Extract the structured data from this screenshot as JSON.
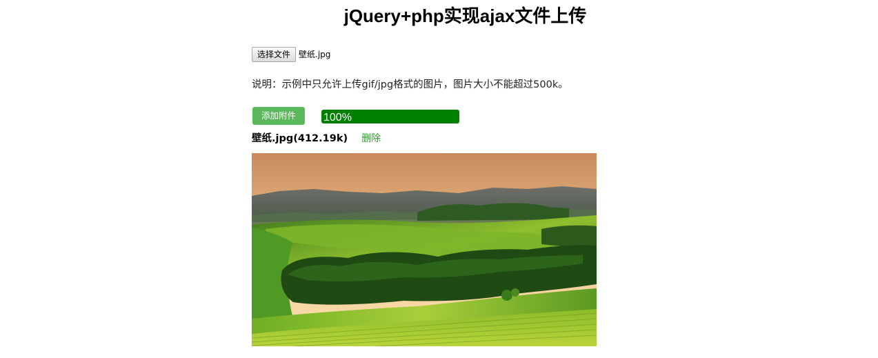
{
  "page": {
    "title": "jQuery+php实现ajax文件上传"
  },
  "file_input": {
    "button_label": "选择文件",
    "selected_file": "壁纸.jpg"
  },
  "note": "说明：示例中只允许上传gif/jpg格式的图片，图片大小不能超过500k。",
  "upload": {
    "add_button_label": "添加附件",
    "progress_text": "100%",
    "progress_value": 1.0,
    "progress_color": "#008000",
    "button_color": "#5cb85c"
  },
  "uploaded_file": {
    "name_and_size": "壁纸.jpg(412.19k)",
    "delete_label": "删除"
  },
  "preview": {
    "alt": "landscape-image"
  }
}
